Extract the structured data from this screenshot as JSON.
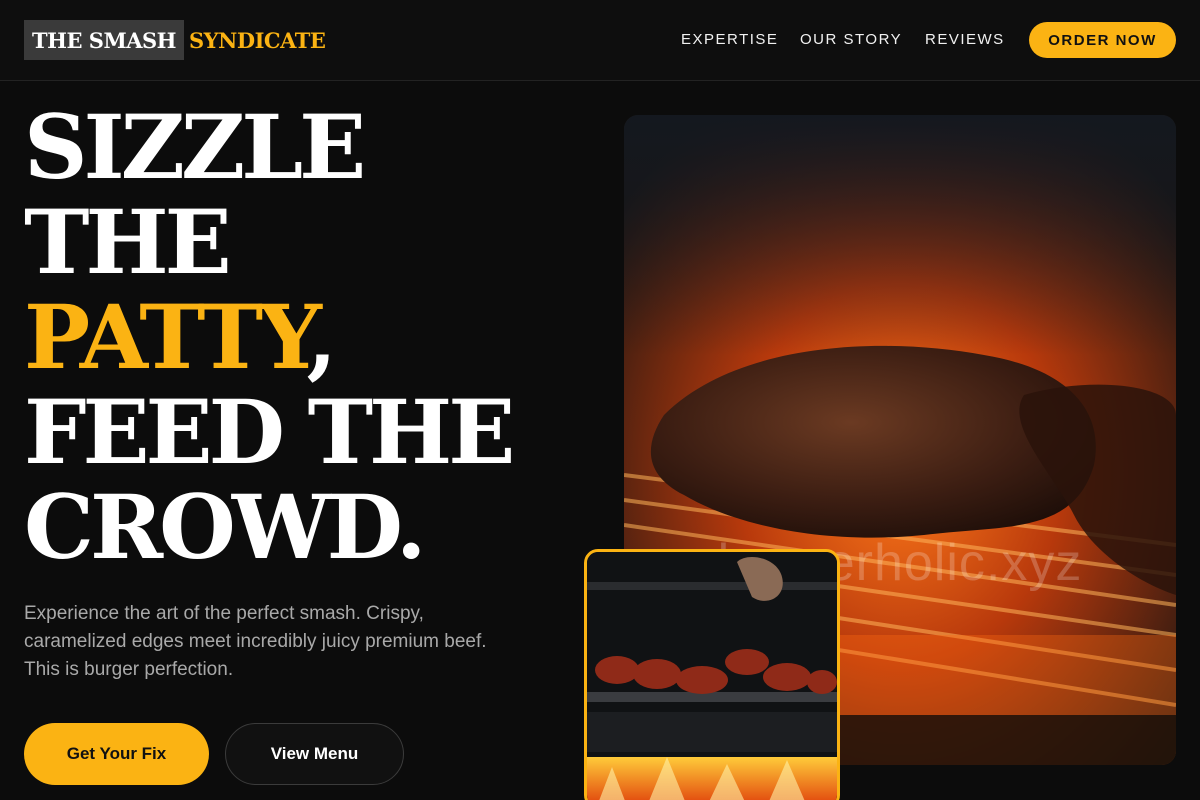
{
  "brand": {
    "name_main": "THE SMASH",
    "name_accent": "SYNDICATE"
  },
  "nav": {
    "items": [
      "EXPERTISE",
      "OUR STORY",
      "REVIEWS"
    ],
    "cta": "ORDER NOW"
  },
  "hero": {
    "line1": "SIZZLE",
    "line2": "THE",
    "line3_accent": "PATTY",
    "line3_punct": ",",
    "line4": "FEED THE",
    "line5": "CROWD.",
    "tagline": "Experience the art of the perfect smash. Crispy, caramelized edges meet incredibly juicy premium beef. This is burger perfection.",
    "primary_cta": "Get Your Fix",
    "secondary_cta": "View Menu"
  },
  "media": {
    "main_image_watermark": "burgerholic.xyz",
    "main_image_icon": "grilled-meat-photo",
    "inset_image_icon": "grill-skewers-photo"
  },
  "colors": {
    "accent": "#fbb313",
    "background": "#0c0c0c",
    "text_muted": "#a9a9a9"
  }
}
